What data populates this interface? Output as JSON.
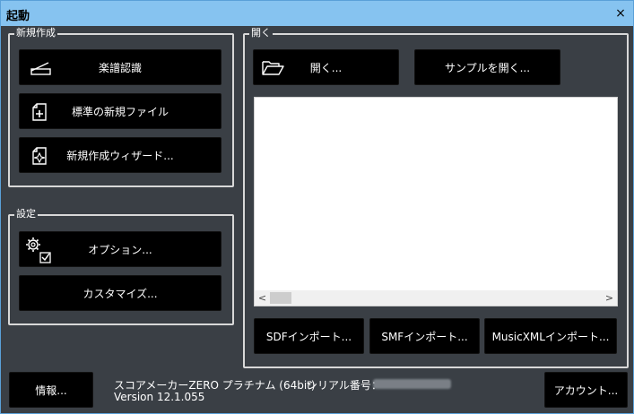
{
  "window": {
    "title": "起動",
    "close_glyph": "×"
  },
  "new_group": {
    "legend": "新規作成",
    "buttons": [
      {
        "label": "楽譜認識",
        "icon": "scanner-icon"
      },
      {
        "label": "標準の新規ファイル",
        "icon": "new-file-icon"
      },
      {
        "label": "新規作成ウィザード...",
        "icon": "wizard-file-icon"
      }
    ]
  },
  "settings_group": {
    "legend": "設定",
    "buttons": [
      {
        "label": "オプション...",
        "icon": "gear-checkbox-icon"
      },
      {
        "label": "カスタマイズ..."
      }
    ]
  },
  "open_group": {
    "legend": "開く",
    "open_label": "開く...",
    "sample_label": "サンプルを開く...",
    "scroll_left": "<",
    "scroll_right": ">",
    "import_buttons": [
      "SDFインポート...",
      "SMFインポート...",
      "MusicXMLインポート..."
    ]
  },
  "footer": {
    "info_label": "情報...",
    "product": "スコアメーカーZERO プラチナム (64bit)",
    "version": "Version 12.1.055",
    "serial_label": "シリアル番号：",
    "account_label": "アカウント..."
  },
  "colors": {
    "titlebar": "#86c3f0",
    "background": "#3a3f45",
    "button": "#000000",
    "border": "#d8d8d8"
  }
}
